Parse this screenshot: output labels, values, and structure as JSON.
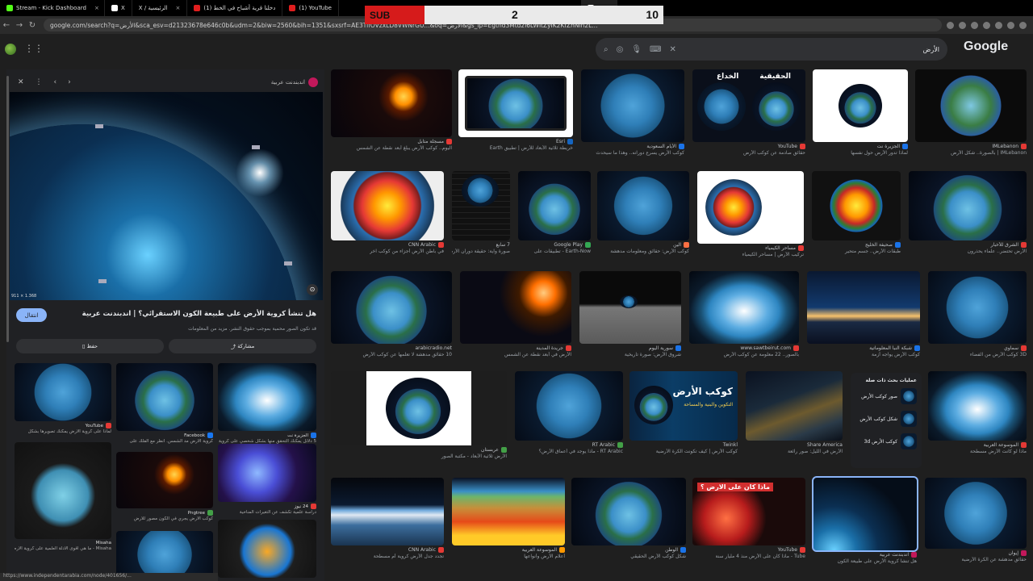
{
  "tabs": [
    {
      "label": "Stream - Kick Dashboard",
      "icon": "kick"
    },
    {
      "label": "X",
      "icon": "x"
    },
    {
      "label": "X / الرئيسية",
      "icon": "x"
    },
    {
      "label": "(1) دخلنا قرية أشباح في الخط",
      "icon": "youtube"
    },
    {
      "label": "(1) YouTube",
      "icon": "youtube"
    },
    {
      "label": "",
      "icon": "google"
    }
  ],
  "sub_counter": {
    "label": "SUB",
    "current": "2",
    "goal": "10"
  },
  "address": {
    "url": "google.com/search?q=الأرض&sca_esv=d21323678e646c0b&udm=2&biw=2560&bih=1351&sxsrf=AE3TifOVzxLD8VWNrGU...&oq=الأرض&gs_lp=Egtnd3Mtd2l6LWltZyIK2KfZhNin2L..."
  },
  "search": {
    "query": "الأرض"
  },
  "google_logo": "Google",
  "panel": {
    "source": "اندبندنت عربية",
    "title": "هل تنشأ كروية الأرض على طبيعة الكون الاستقرائي؟ | اندبندنت عربية",
    "subtitle": "قد تكون الصور محمية بموجب حقوق النشر. مزيد من المعلومات",
    "visit_label": "انتقال",
    "share_label": "مشاركة",
    "save_label": "حفظ",
    "image_dims": "911 × 1.368",
    "related": [
      {
        "source": "YouTube",
        "title": "لماذا على كروية الأرض يمكنك تصويرها بشكل"
      },
      {
        "source": "Facebook",
        "title": "كروية الأرض مد الشمس. انظر مع الفلك على"
      },
      {
        "source": "الجزيرة نت",
        "title": "5 دلائل يمكنك التحقق منها بشكل شخصي على كروية"
      },
      {
        "source": "Misaha",
        "title": "Misaha - ما هي أقوى الأدلة العلمية على كروية الأرض"
      },
      {
        "source": "Pngtree",
        "title": "كوكب الأرض يجري في الكون مصور للأرض"
      },
      {
        "source": "24 نيوز",
        "title": "دراسة علمية تكشف عن التغيرات المناخية"
      }
    ]
  },
  "grid": [
    [
      {
        "source": "مسجلة متابل",
        "title": "اليوم.. كوكب الأرض يبلغ أبعد نقطة عن الشمس"
      },
      {
        "source": "Esri",
        "title": "خريطة ثلاثية الأبعاد للأرض | تطبيق Earth"
      },
      {
        "source": "الأيام السعودية",
        "title": "كوكب الأرض يسرع دورانه.. وهذا ما سيحدث"
      },
      {
        "source": "YouTube",
        "title": "حقائق صادمة عن كوكب الأرض"
      },
      {
        "source": "الجزيرة نت",
        "title": "لماذا تدور الأرض حول نفسها"
      },
      {
        "source": "IMLebanon",
        "title": "IMLebanon | بالصورة.. شكل الأرض"
      }
    ],
    [
      {
        "source": "CNN Arabic",
        "title": "في باطن الأرض أجزاء من كوكب آخر"
      },
      {
        "source": "7 سابع",
        "title": "صورة وآية: حقيقة دوران الأرض"
      },
      {
        "source": "Google Play",
        "title": "Earth-Now - تطبيقات على"
      },
      {
        "source": "الين",
        "title": "كوكب الأرض: حقائق ومعلومات مدهشة"
      },
      {
        "source": "مساحر الكيمياء",
        "title": "تركيب الأرض | مساحر الكيمياء"
      },
      {
        "source": "صحيفة الخليج",
        "title": "طبقات الأرض.. جسم متحير"
      },
      {
        "source": "الشرق للأخبار",
        "title": "الأرض تحتضر.. علماء يحذرون"
      }
    ],
    [
      {
        "source": "arabicradio.net",
        "title": "10 حقائق مدهشة لا تعلمها عن كوكب الأرض"
      },
      {
        "source": "جريدة المدينة",
        "title": "الأرض في أبعد نقطة عن الشمس"
      },
      {
        "source": "سورية اليوم",
        "title": "شروق الأرض: صورة تاريخية"
      },
      {
        "source": "www.sawtbeirut.com",
        "title": "بالصور.. 22 معلومة عن كوكب الأرض"
      },
      {
        "source": "شبكة النبأ المعلوماتية",
        "title": "كوكب الأرض يواجه أزمة"
      },
      {
        "source": "سماوي",
        "title": "3D كوكب الأرض من الفضاء"
      }
    ],
    [
      {
        "source": "عربستان",
        "title": "الأرض ثلاثية الأبعاد - مكتبة الصور"
      },
      {
        "source": "RT Arabic",
        "title": "RT Arabic - ماذا يوجد في أعماق الأرض؟"
      },
      {
        "source": "Twinkl",
        "title": "كوكب الأرض | كيف تكونت الكرة الأرضية"
      },
      {
        "source": "Share America",
        "title": "الأرض في الليل: صور رائعة"
      },
      {
        "source": "الموسوعة العربية",
        "title": "ماذا لو كانت الأرض مسطحة"
      }
    ],
    [
      {
        "source": "CNN Arabic",
        "title": "تجدد جدل الأرض كروية أم مسطحة"
      },
      {
        "source": "الموسوعة العربية",
        "title": "أعلام الأرض وأنواعها"
      },
      {
        "source": "الوطن",
        "title": "شكل كوكب الأرض الحقيقي"
      },
      {
        "source": "YouTube",
        "title": "Tube - ماذا كان على الأرض منذ 4 مليار سنة"
      },
      {
        "source": "اندبندنت عربية",
        "title": "هل تنشأ كروية الأرض على طبيعة الكون"
      },
      {
        "source": "إيوان",
        "title": "حقائق مدهشة عن الكرة الأرضية"
      }
    ]
  ],
  "overlays": {
    "fake_label": "الخداع",
    "real_label": "الحقيقية",
    "kawkab_title": "كوكب الأرض",
    "kawkab_sub": "التكوين والبنية والمساحة",
    "banner_q": "ماذا كان على الارض ؟"
  },
  "suggestions": {
    "heading": "عمليات بحث ذات صلة",
    "items": [
      "صور كوكب الأرض",
      "شكل كوكب الأرض",
      "كوكب الأرض 3d"
    ]
  },
  "statusbar": "https://www.independentarabia.com/node/401656/..."
}
